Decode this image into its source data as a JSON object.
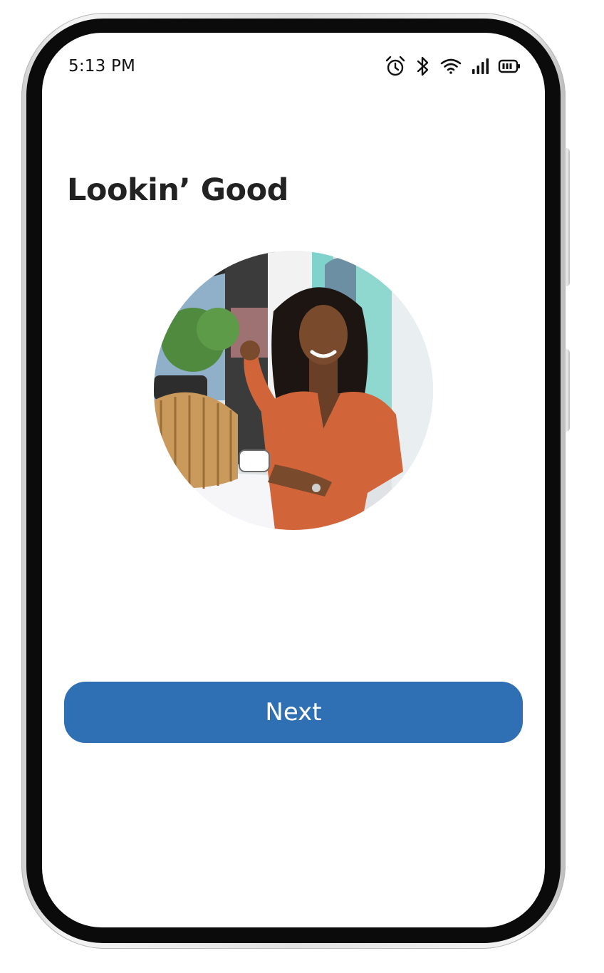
{
  "status_bar": {
    "time": "5:13 PM",
    "icons": [
      "alarm-icon",
      "bluetooth-icon",
      "wifi-icon",
      "signal-icon",
      "battery-icon"
    ]
  },
  "page": {
    "title": "Lookin’ Good"
  },
  "profile_photo": {
    "subject": "Smiling woman in an orange wrap top seated at a cafe table with a bamboo handbag"
  },
  "actions": {
    "next_label": "Next"
  },
  "colors": {
    "accent": "#2f70b5",
    "title_text": "#222222",
    "background": "#ffffff"
  }
}
